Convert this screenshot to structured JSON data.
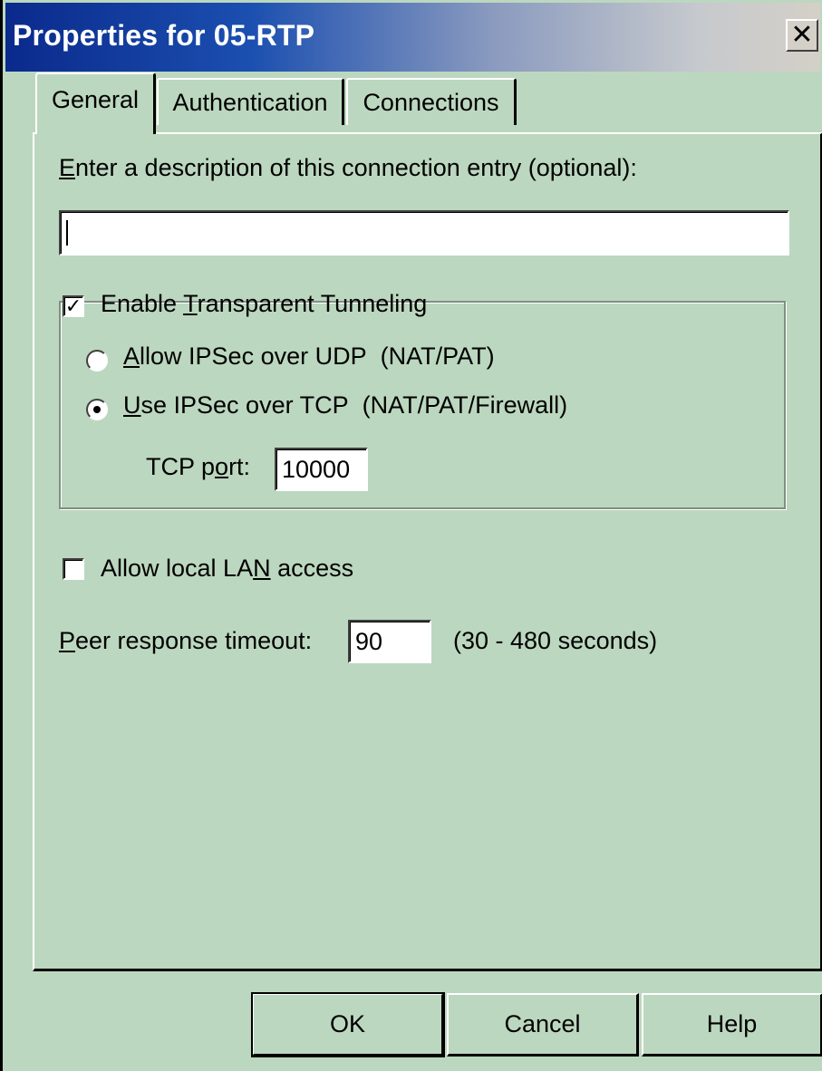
{
  "window": {
    "title": "Properties for 05-RTP"
  },
  "tabs": [
    {
      "label": "General",
      "active": true
    },
    {
      "label": "Authentication",
      "active": false
    },
    {
      "label": "Connections",
      "active": false
    }
  ],
  "general": {
    "description_label": "Enter a description of this connection entry (optional):",
    "description_value": "",
    "transparent_tunneling": {
      "label": "Enable Transparent Tunneling",
      "checked": true,
      "option_udp": "Allow IPSec over UDP  (NAT/PAT)",
      "option_tcp": "Use IPSec over TCP  (NAT/PAT/Firewall)",
      "selected": "tcp",
      "tcp_port_label": "TCP port:",
      "tcp_port_value": "10000"
    },
    "local_lan": {
      "label": "Allow local LAN access",
      "checked": false
    },
    "peer_timeout": {
      "label": "Peer response timeout:",
      "value": "90",
      "range": "(30 - 480 seconds)"
    }
  },
  "buttons": {
    "ok": "OK",
    "cancel": "Cancel",
    "help": "Help"
  },
  "icons": {
    "close": "close-icon",
    "check": "checkmark-icon"
  }
}
